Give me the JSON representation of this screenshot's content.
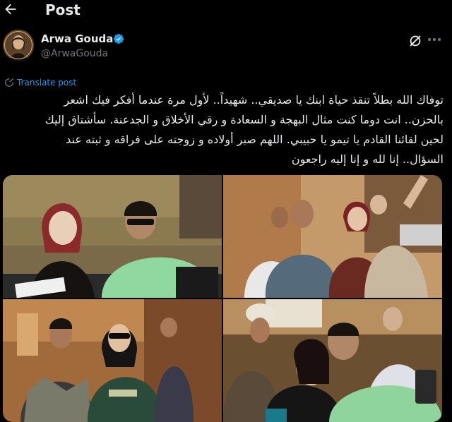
{
  "header": {
    "title": "Post"
  },
  "author": {
    "name": "Arwa Gouda",
    "handle": "@ArwaGouda",
    "verified": true
  },
  "translate_label": "Translate post",
  "post": {
    "lines": [
      "توفاك الله بطلاً تنقذ حياة ابنك يا صديقي.. شهيداً.. لأول مرة عندما أفكر فيك اشعر",
      "بالحزن.. انت دوما كنت مثال البهجة و السعادة و رقي الأخلاق و الجدعنة. سأشتاق إليك",
      "لحين لقائنا القادم يا تيمو يا حبيبي. اللهم صبر أولاده و زوجته على فراقه و ثبته عند",
      "السؤال.. إنا لله و إنا إليه راجعون"
    ]
  },
  "media": {
    "photos": [
      {
        "description": "woman-in-red-scarf-and-man-in-green-hoodie"
      },
      {
        "description": "group-on-film-set"
      },
      {
        "description": "man-in-patterned-shirt-and-woman-in-costume"
      },
      {
        "description": "selfie-woman-and-man-in-green"
      }
    ]
  },
  "colors": {
    "accent": "#1d9bf0",
    "text": "#e7e9ea",
    "muted": "#71767b",
    "background": "#000000"
  }
}
